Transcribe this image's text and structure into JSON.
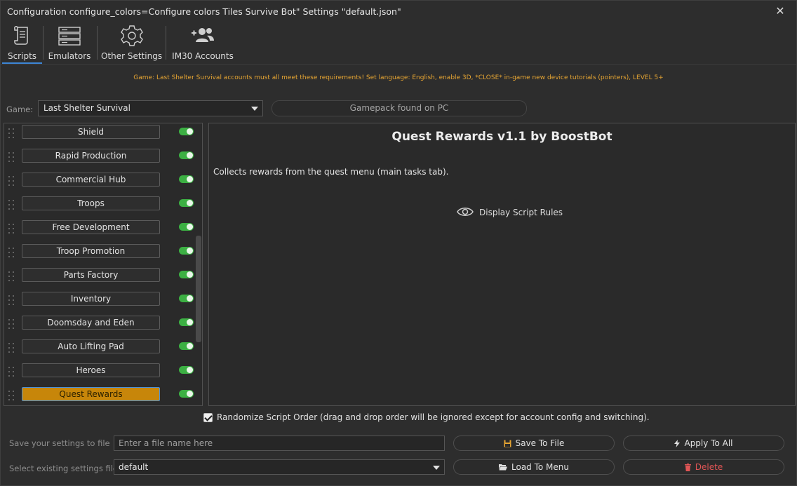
{
  "window": {
    "title": "Configuration configure_colors=Configure colors Tiles Survive Bot\" Settings \"default.json\"",
    "close_symbol": "✕"
  },
  "tabs": [
    {
      "label": "Scripts",
      "icon": "scroll-icon",
      "active": true
    },
    {
      "label": "Emulators",
      "icon": "server-stack-icon",
      "active": false
    },
    {
      "label": "Other Settings",
      "icon": "gear-icon",
      "active": false
    },
    {
      "label": "IM30 Accounts",
      "icon": "add-user-group-icon",
      "active": false
    }
  ],
  "notice": "Game: Last Shelter Survival accounts must all meet these requirements! Set language: English, enable 3D, *CLOSE* in-game new device tutorials (pointers), LEVEL 5+",
  "game": {
    "label": "Game:",
    "selected": "Last Shelter Survival",
    "gamepack_status": "Gamepack found on PC"
  },
  "scripts": [
    {
      "name": "Shield",
      "enabled": true,
      "selected": false
    },
    {
      "name": "Rapid Production",
      "enabled": true,
      "selected": false
    },
    {
      "name": "Commercial Hub",
      "enabled": true,
      "selected": false
    },
    {
      "name": "Troops",
      "enabled": true,
      "selected": false
    },
    {
      "name": "Free Development",
      "enabled": true,
      "selected": false
    },
    {
      "name": "Troop Promotion",
      "enabled": true,
      "selected": false
    },
    {
      "name": "Parts Factory",
      "enabled": true,
      "selected": false
    },
    {
      "name": "Inventory",
      "enabled": true,
      "selected": false
    },
    {
      "name": "Doomsday and Eden",
      "enabled": true,
      "selected": false
    },
    {
      "name": "Auto Lifting Pad",
      "enabled": true,
      "selected": false
    },
    {
      "name": "Heroes",
      "enabled": true,
      "selected": false
    },
    {
      "name": "Quest Rewards",
      "enabled": true,
      "selected": true
    }
  ],
  "script_detail": {
    "title": "Quest Rewards v1.1 by BoostBot",
    "description": "Collects rewards from the quest menu (main tasks tab).",
    "rules_link": "Display Script Rules",
    "rules_icon": "eye-icon"
  },
  "randomize": {
    "checked": true,
    "label": "Randomize Script Order (drag and drop order will be ignored except for account config and switching)."
  },
  "save_row": {
    "label": "Save your settings to file",
    "placeholder": "Enter a file name here",
    "value": "",
    "save_button": "Save To File",
    "save_icon": "floppy-disk-icon",
    "apply_button": "Apply To All",
    "apply_icon": "lightning-icon"
  },
  "load_row": {
    "label": "Select existing settings file",
    "selected": "default",
    "load_button": "Load To Menu",
    "load_icon": "folder-open-icon",
    "delete_button": "Delete",
    "delete_icon": "trash-icon"
  },
  "colors": {
    "accent_blue": "#3d86d6",
    "notice_orange": "#e6a533",
    "selected_script": "#c7860a",
    "toggle_on": "#3cb043",
    "danger": "#e05555"
  }
}
